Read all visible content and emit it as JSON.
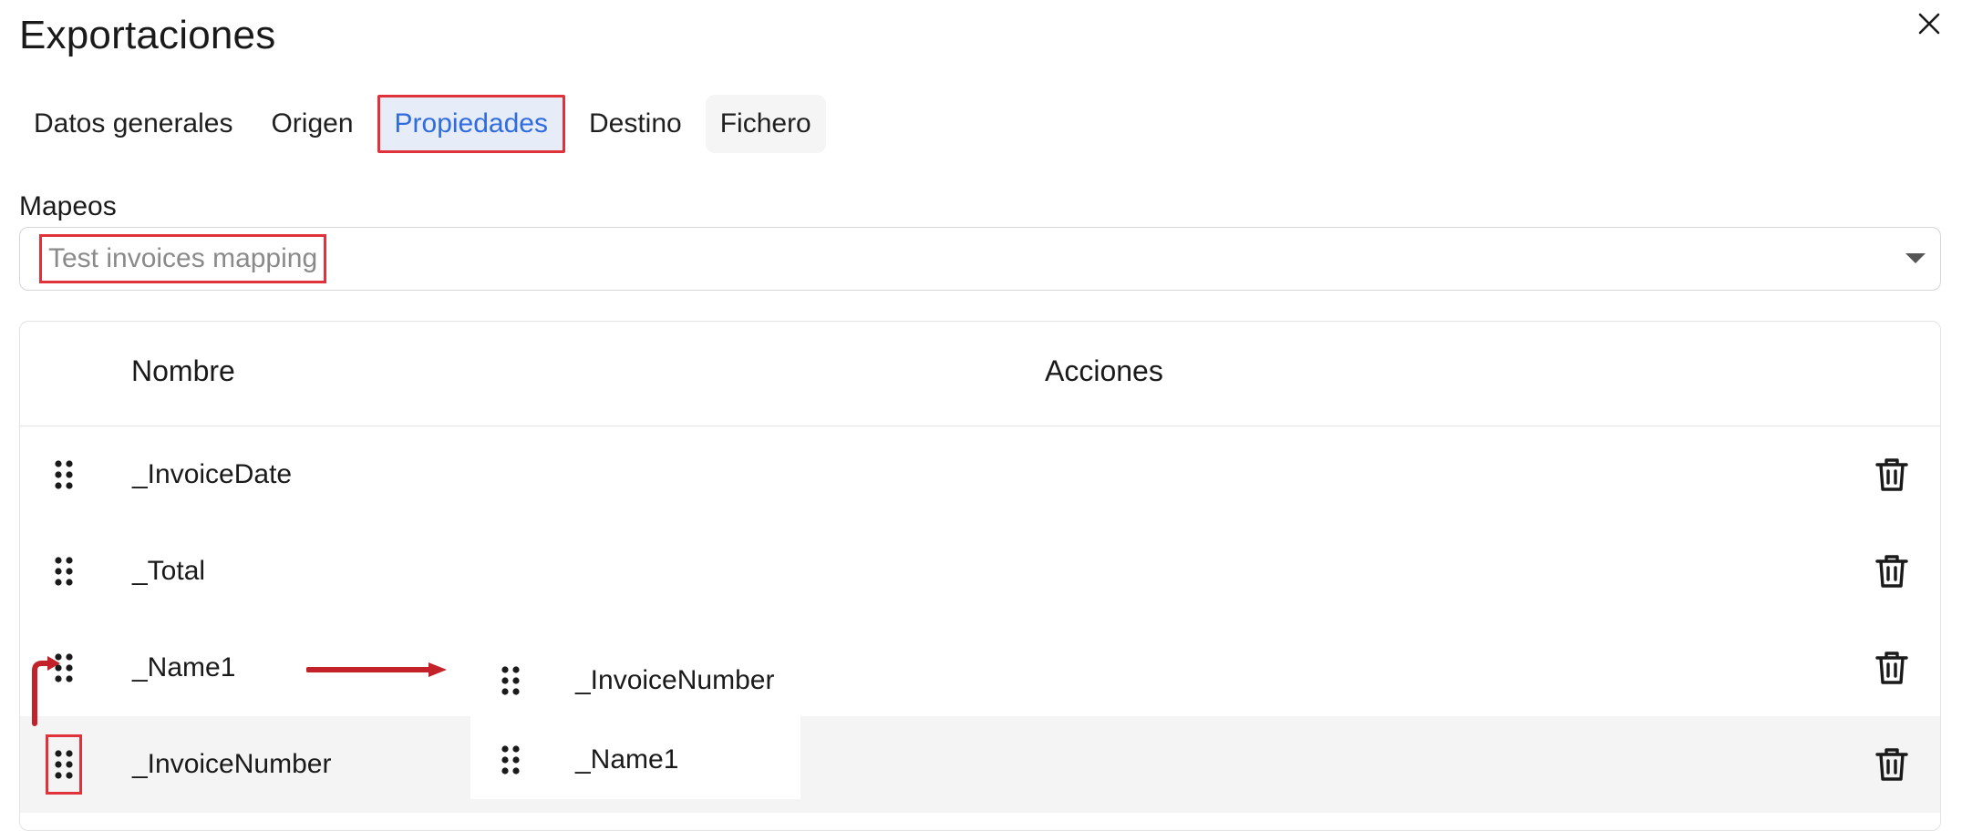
{
  "dialog": {
    "title": "Exportaciones"
  },
  "tabs": [
    {
      "label": "Datos generales"
    },
    {
      "label": "Origen"
    },
    {
      "label": "Propiedades"
    },
    {
      "label": "Destino"
    },
    {
      "label": "Fichero"
    }
  ],
  "mapeos": {
    "label": "Mapeos",
    "value": "Test invoices mapping"
  },
  "table": {
    "headers": {
      "nombre": "Nombre",
      "acciones": "Acciones"
    },
    "rows": [
      {
        "name": "_InvoiceDate"
      },
      {
        "name": "_Total"
      },
      {
        "name": "_Name1"
      },
      {
        "name": "_InvoiceNumber"
      }
    ]
  },
  "drag_preview": {
    "items": [
      {
        "name": "_InvoiceNumber"
      },
      {
        "name": "_Name1"
      }
    ]
  },
  "icons": {
    "close": "close-icon",
    "caret": "chevron-down-icon",
    "grip": "drag-handle-icon",
    "delete": "trash-icon"
  },
  "colors": {
    "accent": "#2f6ce0",
    "highlight": "#e0323a",
    "arrow": "#c4222a"
  }
}
